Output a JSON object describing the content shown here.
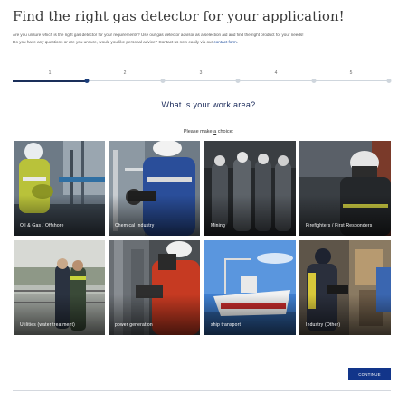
{
  "page": {
    "title": "Find the right gas detector for your application!",
    "intro_line1": "Are you unsure which is the right gas detector for your requirements? Use our gas detector advisor as a selection aid and find the right product for your needs!",
    "intro_line2_prefix": "Do you have any questions or are you unsure, would you like personal advice? Contact us now easily via our ",
    "intro_link": "contact form",
    "intro_line2_suffix": "."
  },
  "stepper": {
    "steps": [
      "1",
      "2",
      "3",
      "4",
      "5"
    ],
    "current_step": 1,
    "total_steps": 5
  },
  "question": "What is your work area?",
  "hint": {
    "prefix": "Please make ",
    "emphasis": "a",
    "suffix": " choice:"
  },
  "options": [
    {
      "label": "Oil & Gas / Offshore"
    },
    {
      "label": "Chemical Industry"
    },
    {
      "label": "Mining"
    },
    {
      "label": "Firefighters / First Responders"
    },
    {
      "label": "Utilities (water treatment)"
    },
    {
      "label": "power generation"
    },
    {
      "label": "ship transport"
    },
    {
      "label": "Industry (Other)"
    }
  ],
  "continue_label": "CONTINUE",
  "colors": {
    "accent": "#12358a",
    "heading": "#1a2a5a",
    "link": "#1f4e9c"
  }
}
